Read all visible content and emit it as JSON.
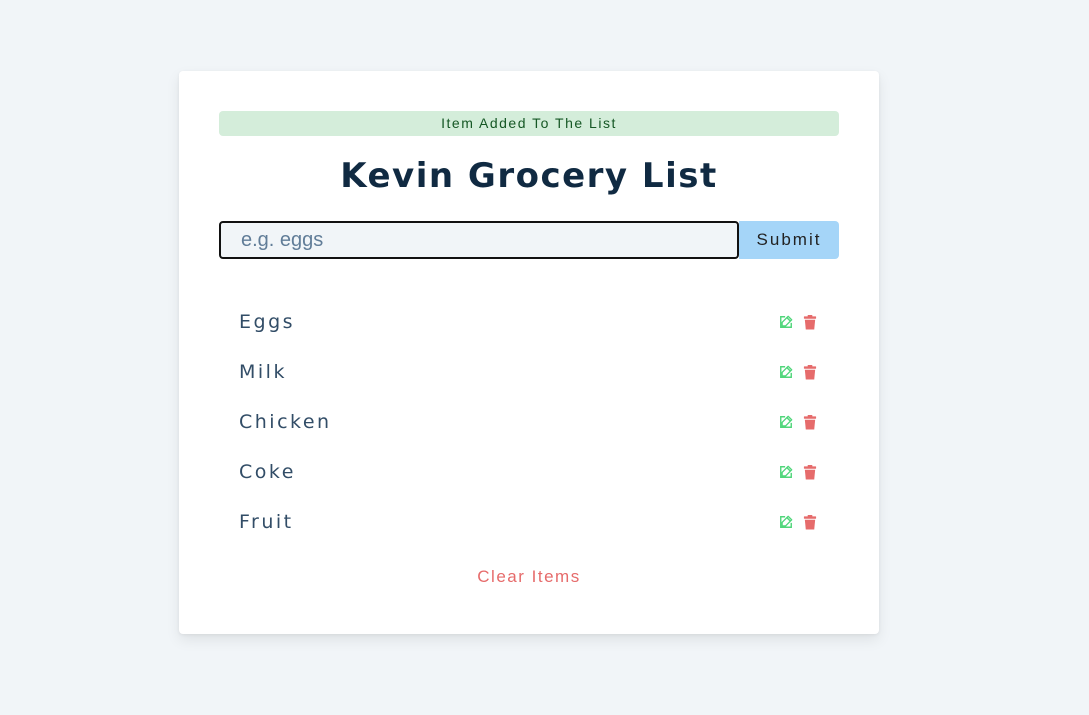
{
  "alert": {
    "text": "Item Added To The List",
    "color": "#155724",
    "background": "#d4edda"
  },
  "header": {
    "title": "Kevin Grocery List"
  },
  "form": {
    "input_value": "",
    "input_placeholder": "e.g. eggs",
    "submit_label": "Submit"
  },
  "items": [
    {
      "title": "Eggs"
    },
    {
      "title": "Milk"
    },
    {
      "title": "Chicken"
    },
    {
      "title": "Coke"
    },
    {
      "title": "Fruit"
    }
  ],
  "icons": {
    "edit": "edit-icon",
    "delete": "trash-icon"
  },
  "colors": {
    "edit": "#4fd67a",
    "delete": "#e66b6b",
    "accent": "#a5d5f8"
  },
  "footer": {
    "clear_label": "Clear Items"
  }
}
